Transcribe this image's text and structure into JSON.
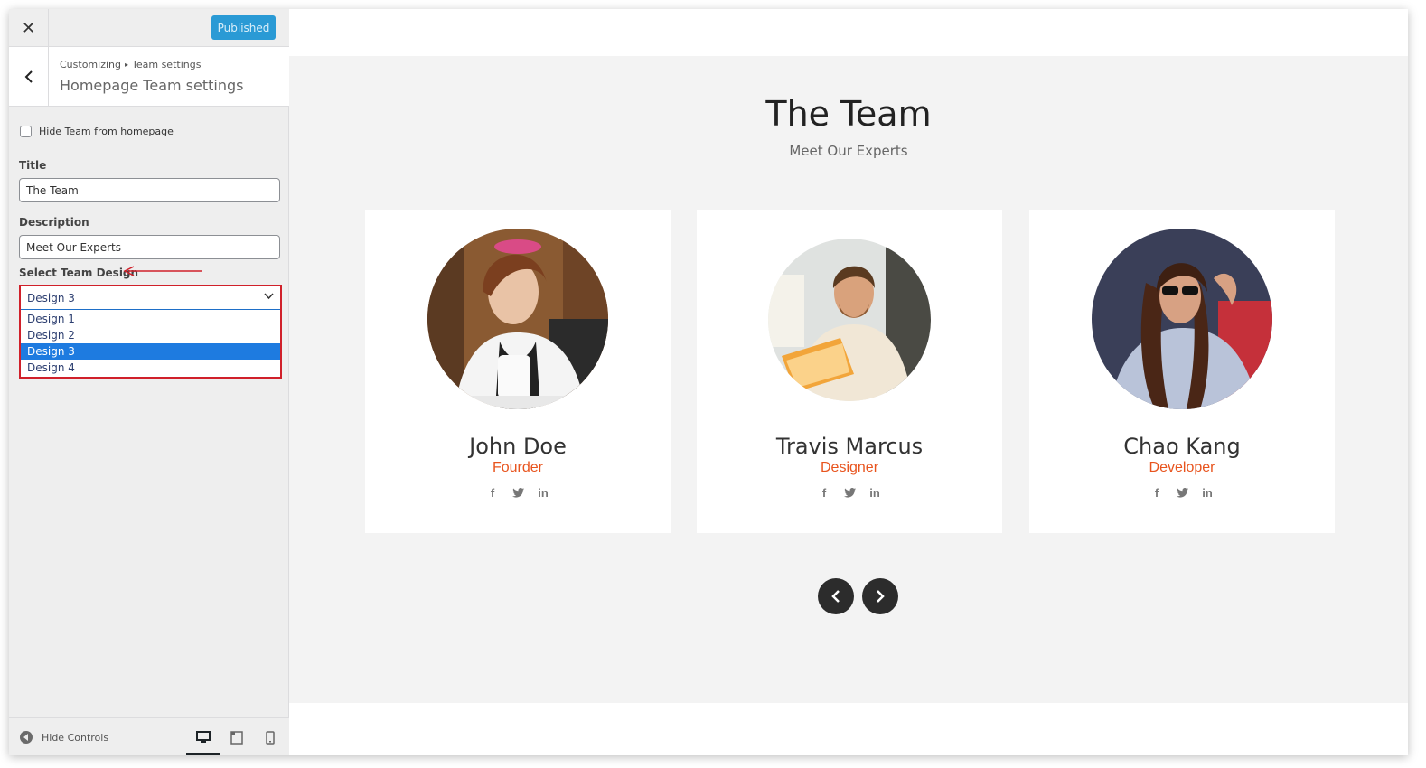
{
  "sidebar": {
    "close_icon": "close-icon",
    "publish_label": "Published",
    "breadcrumb": {
      "root": "Customizing",
      "section": "Team settings"
    },
    "section_title": "Homepage Team settings",
    "hide_team_label": "Hide Team from homepage",
    "title_label": "Title",
    "title_value": "The Team",
    "description_label": "Description",
    "description_value": "Meet Our Experts",
    "select_label": "Select Team Design",
    "select_value": "Design 3",
    "select_options": [
      "Design 1",
      "Design 2",
      "Design 3",
      "Design 4"
    ],
    "hide_controls_label": "Hide Controls"
  },
  "preview": {
    "title": "The Team",
    "subtitle": "Meet Our Experts",
    "members": [
      {
        "name": "John Doe",
        "role": "Fourder"
      },
      {
        "name": "Travis Marcus",
        "role": "Designer"
      },
      {
        "name": "Chao Kang",
        "role": "Developer"
      }
    ]
  },
  "colors": {
    "accent": "#e8541e",
    "publish": "#2a9ad5",
    "highlight": "#d0202a",
    "selected_option": "#1e7be0"
  }
}
